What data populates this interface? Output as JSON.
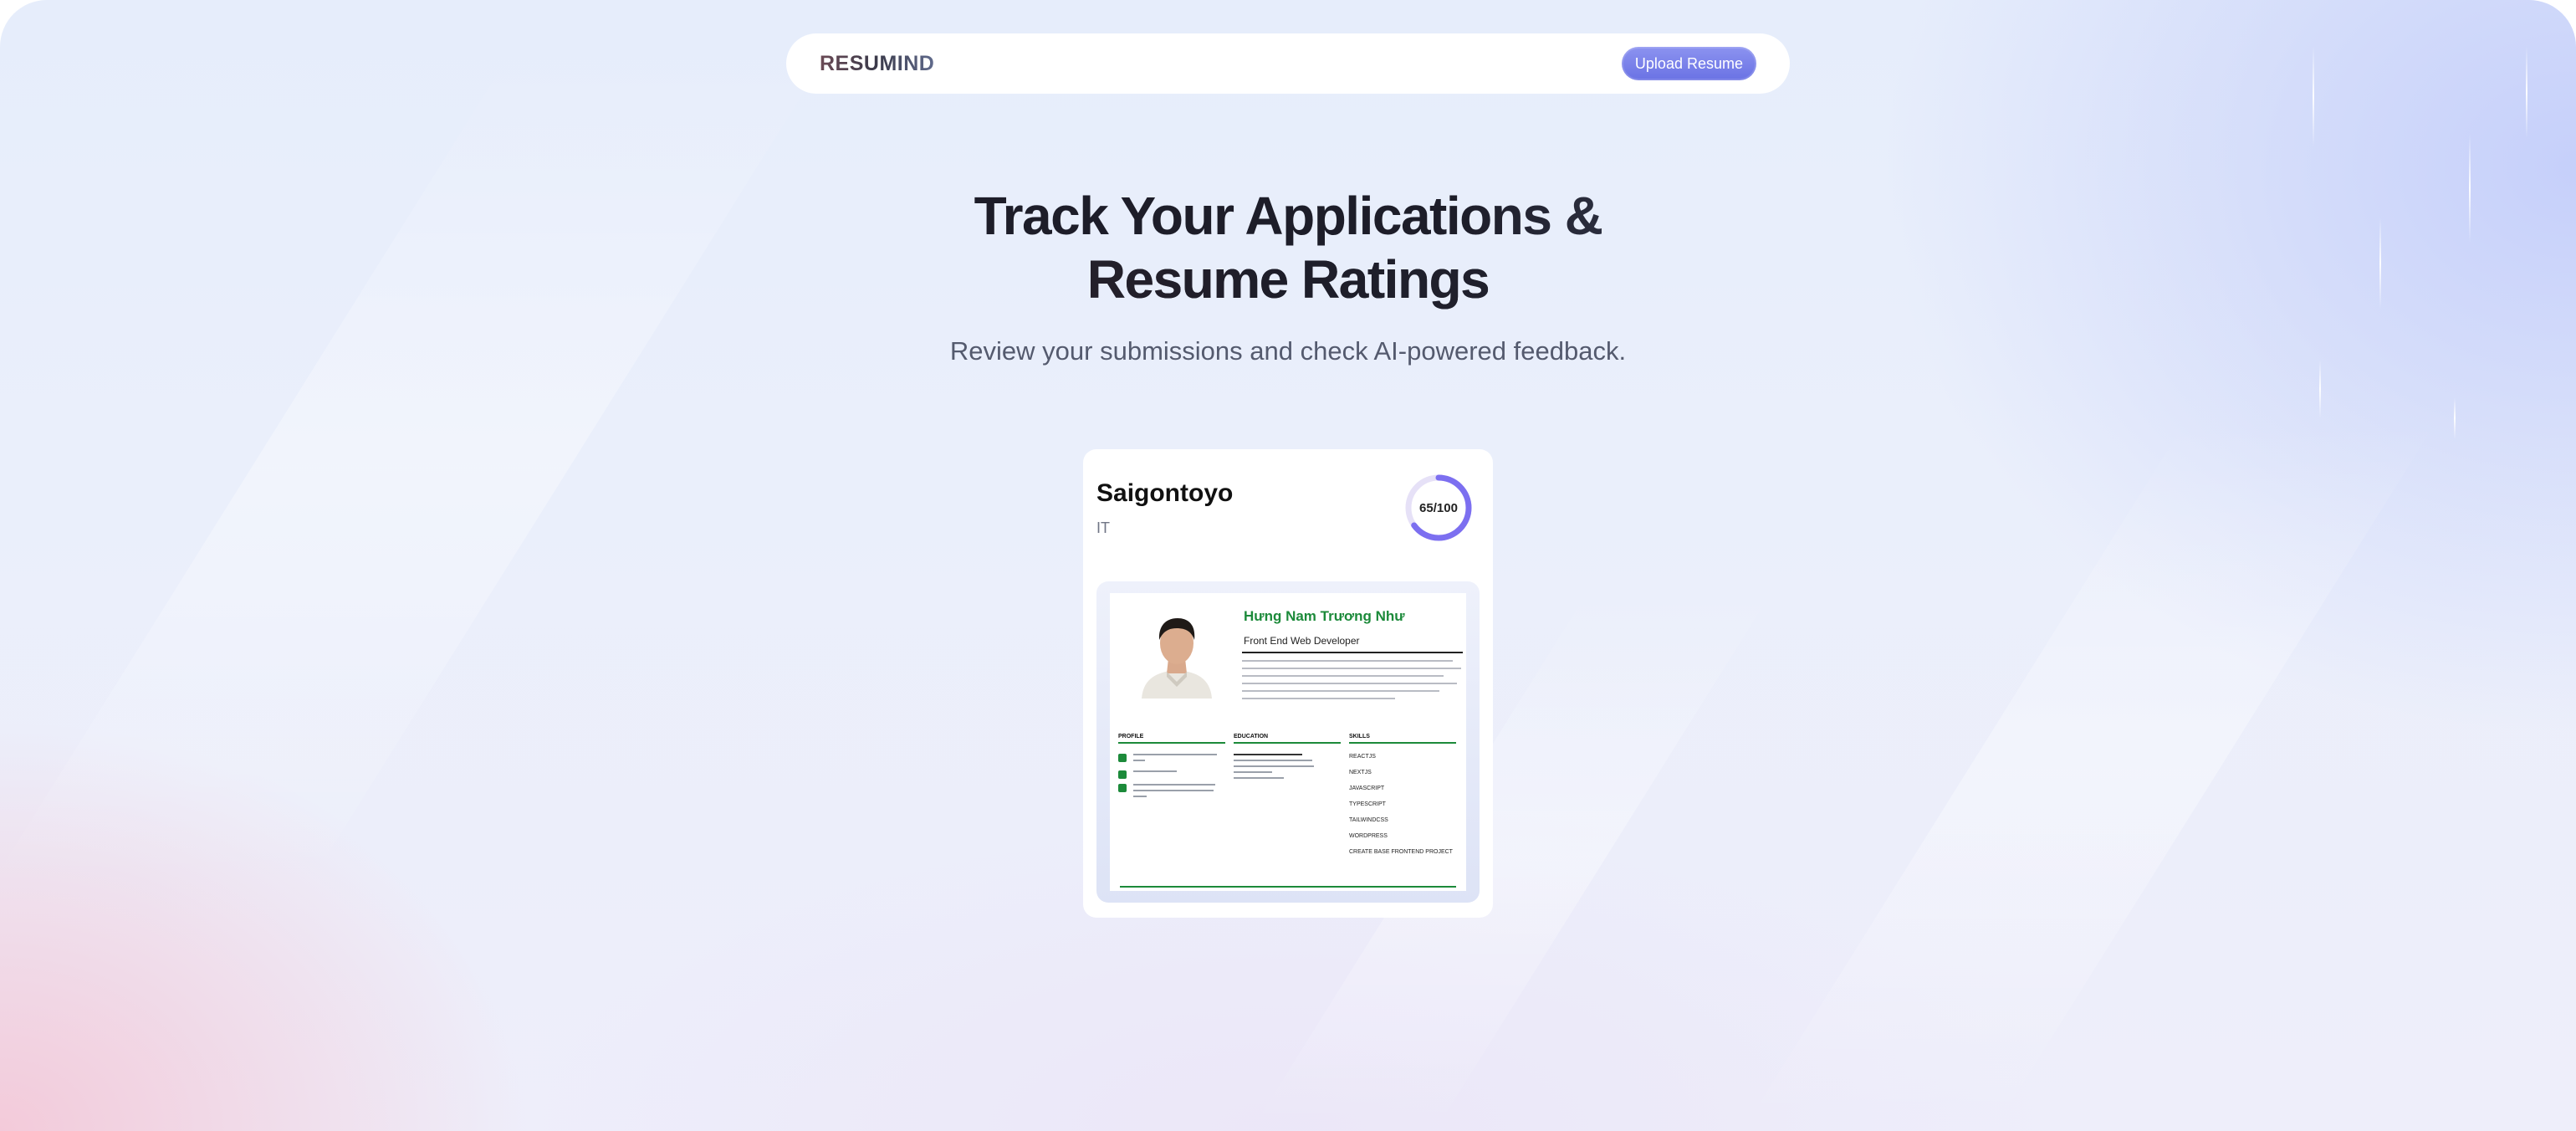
{
  "navbar": {
    "logo": "RESUMIND",
    "upload_button": "Upload Resume"
  },
  "hero": {
    "title_line1": "Track Your Applications &",
    "title_line2": "Resume Ratings",
    "subtitle": "Review your submissions and check AI-powered feedback."
  },
  "resume_card": {
    "company": "Saigontoyo",
    "job_title": "IT",
    "score": 65,
    "score_max": 100,
    "score_label": "65/100",
    "score_color": "#7c6ff0",
    "preview": {
      "name": "Hưng Nam Trương Như",
      "title": "Front End Web Developer",
      "accent_color": "#1c8a3a",
      "sections": {
        "profile": "PROFILE",
        "education": "EDUCATION",
        "skills": "SKILLS"
      },
      "skills": [
        "REACTJS",
        "NEXTJS",
        "JAVASCRIPT",
        "TYPESCRIPT",
        "TAILWINDCSS",
        "WORDPRESS",
        "CREATE BASE FRONTEND PROJECT"
      ]
    }
  }
}
